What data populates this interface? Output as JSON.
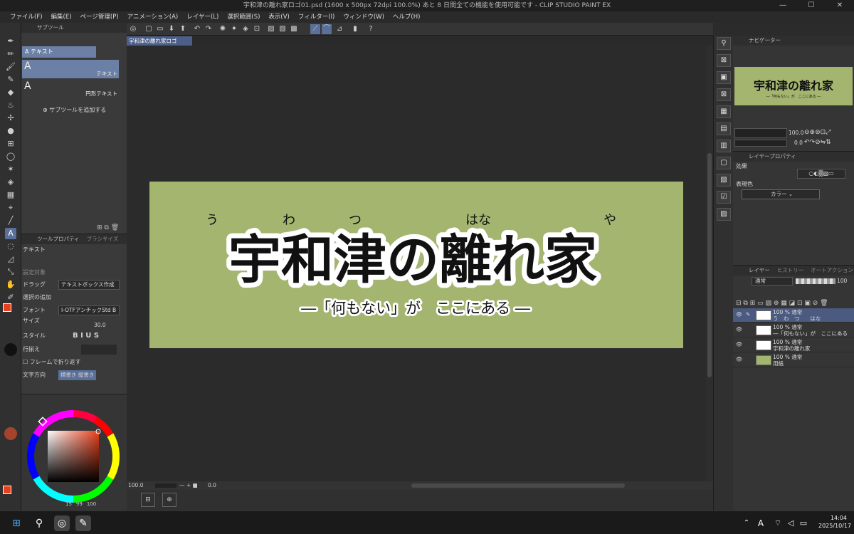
{
  "window": {
    "title": "宇和津の離れ家ロゴ01.psd (1600 x 500px 72dpi 100.0%)  あと 8 日間全ての機能を使用可能です - CLIP STUDIO PAINT EX",
    "minimize": "—",
    "maximize": "☐",
    "close": "✕"
  },
  "menu": [
    "ファイル(F)",
    "編集(E)",
    "ページ管理(P)",
    "アニメーション(A)",
    "レイヤー(L)",
    "選択範囲(S)",
    "表示(V)",
    "フィルター(I)",
    "ウィンドウ(W)",
    "ヘルプ(H)"
  ],
  "subtool": {
    "tab": "サブツール",
    "header_item": "テキスト",
    "items": [
      "テキスト",
      "円形テキスト"
    ],
    "add_label": "サブツールを追加する"
  },
  "toolprop": {
    "tabs": [
      "ツールプロパティ",
      "ブラシサイズ"
    ],
    "tool_name": "テキスト",
    "rows": [
      {
        "label": "設定対象",
        "value": ""
      },
      {
        "label": "ドラッグ",
        "value": "テキストボックス作成"
      },
      {
        "label": "選択の追加",
        "value": ""
      },
      {
        "label": "フォント",
        "value": "I-OTFアンチックStd B"
      },
      {
        "label": "サイズ",
        "value": "30.0"
      },
      {
        "label": "スタイル",
        "value": "B I U S"
      },
      {
        "label": "行揃え",
        "value": ""
      },
      {
        "label": "フレームで折り返す",
        "value": ""
      },
      {
        "label": "文字方向",
        "value": "横書き  縦書き"
      }
    ]
  },
  "color": {
    "main": "#e8401c",
    "sub": "#ffffff",
    "readout_h": "15",
    "readout_s": "99",
    "readout_v": "100"
  },
  "document": {
    "tab": "宇和津の離れ家ロゴ01.psd"
  },
  "artwork": {
    "bg_color": "#a3b56f",
    "furigana": [
      "う",
      "わ",
      "つ",
      "はな",
      "や"
    ],
    "main_title": "宇和津の離れ家",
    "subtitle": "―「何もない」が　ここにある ―"
  },
  "statusbar": {
    "zoom": "100.0",
    "angle": "0.0"
  },
  "navigator": {
    "tab": "ナビゲーター",
    "zoom": "100.0",
    "angle": "0.0"
  },
  "layerprop": {
    "tab": "レイヤープロパティ",
    "effect": "効果",
    "expression": "表現色",
    "color_mode": "カラー"
  },
  "layers": {
    "tabs": [
      "レイヤー",
      "ヒストリー",
      "オートアクション"
    ],
    "blend": "通常",
    "opacity": "100",
    "rows": [
      {
        "line1": "100 % 通常",
        "line2": "う　わ　つ　　はな"
      },
      {
        "line1": "100 % 通常",
        "line2": "―「何もない」が　ここにある"
      },
      {
        "line1": "100 % 通常",
        "line2": "宇和津の離れ家"
      },
      {
        "line1": "100 % 通常",
        "line2": "用紙"
      }
    ]
  },
  "taskbar": {
    "time": "14:04",
    "date": "2025/10/17",
    "ime": "A"
  }
}
